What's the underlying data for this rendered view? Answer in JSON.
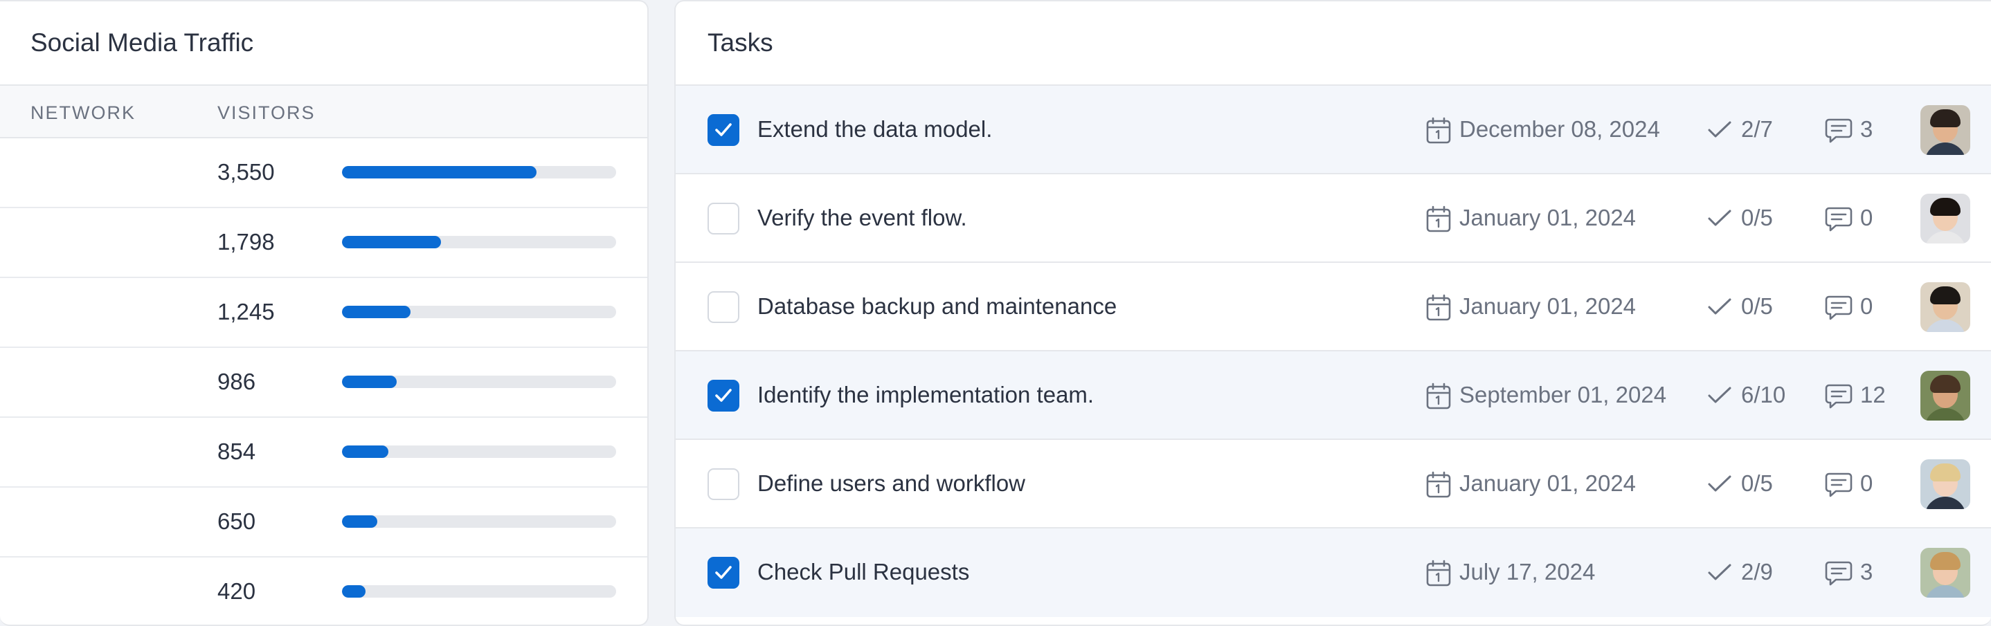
{
  "traffic": {
    "title": "Social Media Traffic",
    "columns": {
      "network": "NETWORK",
      "visitors": "VISITORS"
    },
    "rows": [
      {
        "visitors": "3,550",
        "share": 0.71
      },
      {
        "visitors": "1,798",
        "share": 0.36
      },
      {
        "visitors": "1,245",
        "share": 0.25
      },
      {
        "visitors": "986",
        "share": 0.2
      },
      {
        "visitors": "854",
        "share": 0.17
      },
      {
        "visitors": "650",
        "share": 0.13
      },
      {
        "visitors": "420",
        "share": 0.085
      }
    ],
    "bar_color": "#0b6bd3"
  },
  "tasks": {
    "title": "Tasks",
    "items": [
      {
        "title": "Extend the data model.",
        "done": true,
        "due": "December 08, 2024",
        "subtasks": "2/7",
        "comments": "3",
        "avatar": {
          "skin": "#e2b38f",
          "hair": "#2a211c",
          "shirt": "#2f3b4d",
          "bg": "#c8c2b6"
        }
      },
      {
        "title": "Verify the event flow.",
        "done": false,
        "due": "January 01, 2024",
        "subtasks": "0/5",
        "comments": "0",
        "avatar": {
          "skin": "#f0cdb2",
          "hair": "#1a1410",
          "shirt": "#e9e9ea",
          "bg": "#dedfe3"
        }
      },
      {
        "title": "Database backup and maintenance",
        "done": false,
        "due": "January 01, 2024",
        "subtasks": "0/5",
        "comments": "0",
        "avatar": {
          "skin": "#e7c09e",
          "hair": "#1c1815",
          "shirt": "#cfd8e4",
          "bg": "#ddd3c3"
        }
      },
      {
        "title": "Identify the implementation team.",
        "done": true,
        "due": "September 01, 2024",
        "subtasks": "6/10",
        "comments": "12",
        "avatar": {
          "skin": "#d9a57f",
          "hair": "#4a3424",
          "shirt": "#5a6e3e",
          "bg": "#7a8b5b"
        }
      },
      {
        "title": "Define users and workflow",
        "done": false,
        "due": "January 01, 2024",
        "subtasks": "0/5",
        "comments": "0",
        "avatar": {
          "skin": "#f2d2bd",
          "hair": "#e2c98f",
          "shirt": "#2b3444",
          "bg": "#c7d3dc"
        }
      },
      {
        "title": "Check Pull Requests",
        "done": true,
        "due": "July 17, 2024",
        "subtasks": "2/9",
        "comments": "3",
        "avatar": {
          "skin": "#efc9ae",
          "hair": "#c89a5c",
          "shirt": "#9fb8c8",
          "bg": "#b5c3a8"
        }
      }
    ],
    "accent": "#0b6bd3"
  }
}
